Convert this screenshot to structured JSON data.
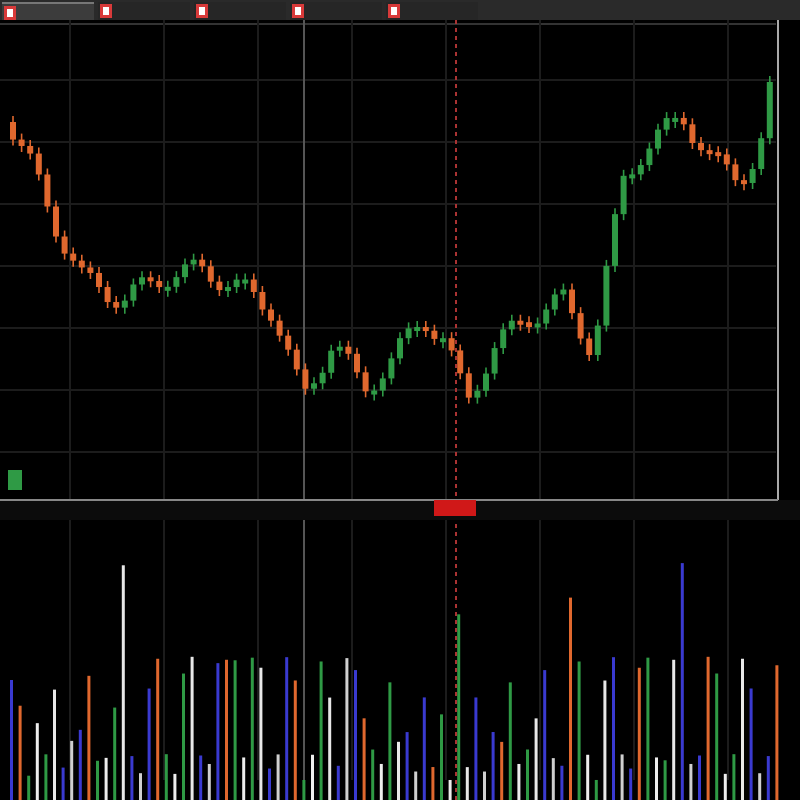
{
  "tabs": [
    {
      "selected": true
    },
    {
      "selected": false
    },
    {
      "selected": false
    },
    {
      "selected": false
    },
    {
      "selected": false
    }
  ],
  "price_chart": {
    "kind": "candlestick"
  },
  "volume_chart": {
    "kind": "volume"
  }
}
